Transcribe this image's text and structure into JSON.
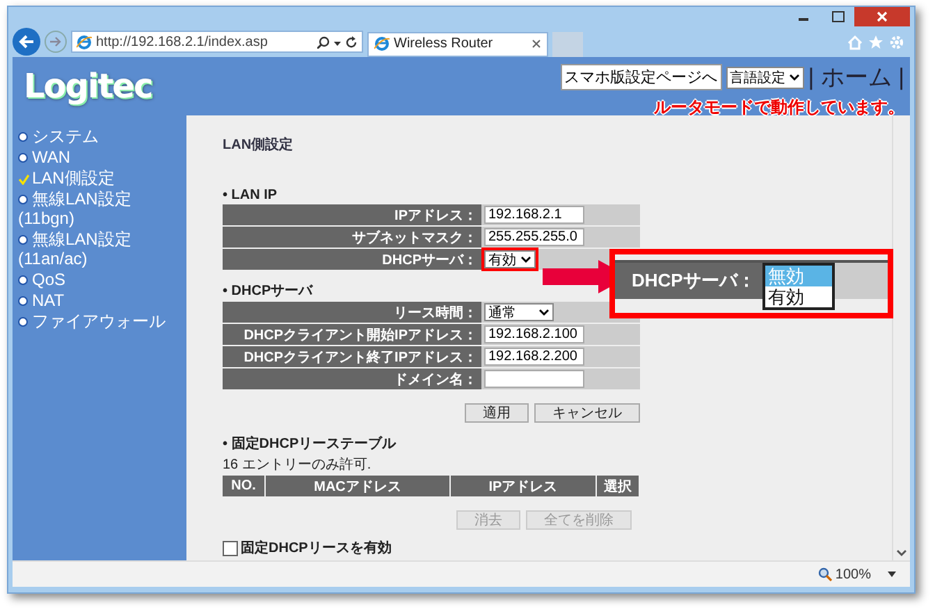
{
  "browser": {
    "address": "http://192.168.2.1/index.asp",
    "tab_title": "Wireless Router",
    "zoom": "100%"
  },
  "header": {
    "logo": "Logitec",
    "smartphone_button": "スマホ版設定ページへ",
    "language_select": "言語設定",
    "home_link": "| ホーム |",
    "mode_status": "ルータモードで動作しています。"
  },
  "sidebar": {
    "items": [
      {
        "label": "システム",
        "selected": false
      },
      {
        "label": "WAN",
        "selected": false
      },
      {
        "label": "LAN側設定",
        "selected": true
      },
      {
        "label": "無線LAN設定(11bgn)",
        "selected": false
      },
      {
        "label": "無線LAN設定(11an/ac)",
        "selected": false
      },
      {
        "label": "QoS",
        "selected": false
      },
      {
        "label": "NAT",
        "selected": false
      },
      {
        "label": "ファイアウォール",
        "selected": false
      }
    ]
  },
  "page_title": "LAN側設定",
  "sections": [
    {
      "heading": "•  LAN IP",
      "rows": [
        {
          "kind": "input",
          "label": "IPアドレス：",
          "value": "192.168.2.1",
          "highlighted": false
        },
        {
          "kind": "input",
          "label": "サブネットマスク：",
          "value": "255.255.255.0",
          "highlighted": false
        },
        {
          "kind": "select",
          "label": "DHCPサーバ：",
          "value": "有効",
          "highlighted": true
        }
      ]
    },
    {
      "heading": "•  DHCPサーバ",
      "rows": [
        {
          "kind": "select",
          "label": "リース時間：",
          "value": "通常",
          "highlighted": false
        },
        {
          "kind": "input",
          "label": "DHCPクライアント開始IPアドレス：",
          "value": "192.168.2.100",
          "highlighted": false
        },
        {
          "kind": "input",
          "label": "DHCPクライアント終了IPアドレス：",
          "value": "192.168.2.200",
          "highlighted": false
        },
        {
          "kind": "input",
          "label": "ドメイン名：",
          "highlighted": false
        }
      ]
    }
  ],
  "buttons": [
    {
      "label": "適用",
      "disabled": false
    },
    {
      "label": "キャンセル",
      "disabled": false
    }
  ],
  "static_lease": {
    "heading": "•  固定DHCPリーステーブル",
    "note": "16 エントリーのみ許可.",
    "columns": [
      "NO.",
      "MACアドレス",
      "IPアドレス",
      "選択"
    ],
    "buttons": [
      {
        "label": "消去",
        "disabled": true
      },
      {
        "label": "全てを削除",
        "disabled": true
      }
    ],
    "enable_checkbox": {
      "label": "固定DHCPリースを有効",
      "checked": false
    }
  },
  "callout": {
    "label": "DHCPサーバ：",
    "options": [
      {
        "label": "無効",
        "selected": true
      },
      {
        "label": "有効",
        "selected": false
      }
    ]
  }
}
